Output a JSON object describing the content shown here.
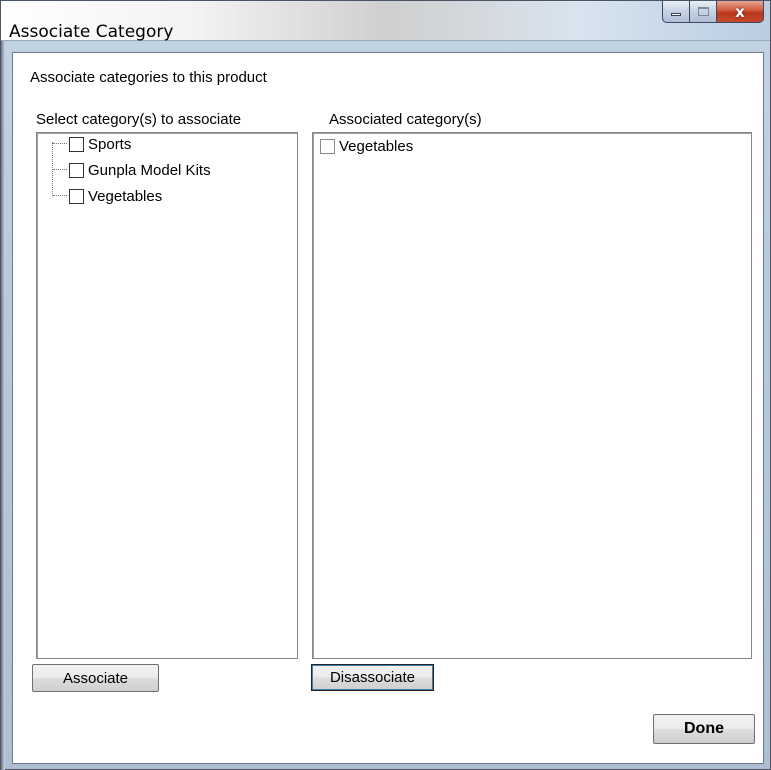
{
  "window": {
    "title": "Associate Category",
    "controls": {
      "minimize": "minimize",
      "maximize": "maximize",
      "close": "x"
    }
  },
  "header": {
    "text": "Associate categories to this product"
  },
  "available": {
    "label": "Select category(s) to associate",
    "items": [
      {
        "label": "Sports",
        "checked": false
      },
      {
        "label": "Gunpla Model Kits",
        "checked": false
      },
      {
        "label": "Vegetables",
        "checked": false
      }
    ],
    "button_label": "Associate"
  },
  "associated": {
    "label": "Associated category(s)",
    "items": [
      {
        "label": "Vegetables",
        "checked": false
      }
    ],
    "button_label": "Disassociate"
  },
  "footer": {
    "done_label": "Done"
  },
  "icons": [
    "minimize-icon",
    "maximize-icon",
    "close-icon",
    "checkbox-icon"
  ]
}
